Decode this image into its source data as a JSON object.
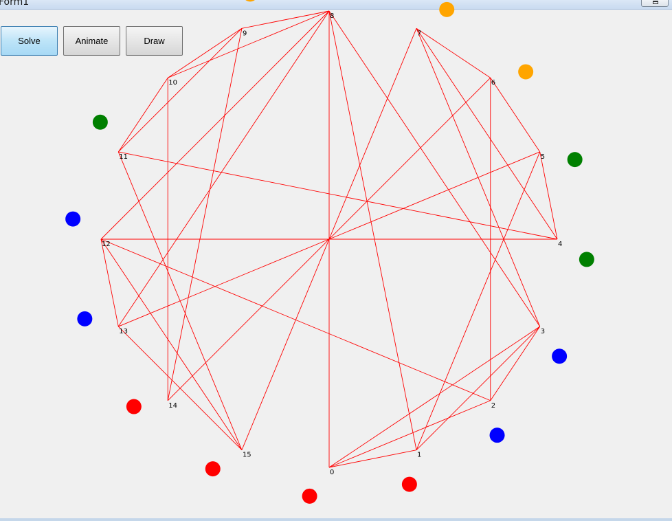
{
  "window": {
    "title": "Form1"
  },
  "toolbar": {
    "solve_label": "Solve",
    "animate_label": "Animate",
    "draw_label": "Draw"
  },
  "graph": {
    "line_color": "#ff0000",
    "node_labels": [
      "0",
      "1",
      "2",
      "3",
      "4",
      "5",
      "6",
      "7",
      "8",
      "9",
      "10",
      "11",
      "12",
      "13",
      "14",
      "15"
    ],
    "node_colors": [
      "#ff0000",
      "#ff0000",
      "#0000ff",
      "#0000ff",
      "#008000",
      "#008000",
      "#ffa500",
      "#ffa500",
      "#ffa500",
      "#ffa500",
      "#008000",
      "#008000",
      "#0000ff",
      "#0000ff",
      "#ff0000",
      "#ff0000"
    ],
    "edges": [
      [
        0,
        8
      ],
      [
        0,
        3
      ],
      [
        0,
        2
      ],
      [
        0,
        1
      ],
      [
        1,
        8
      ],
      [
        1,
        5
      ],
      [
        1,
        3
      ],
      [
        2,
        6
      ],
      [
        2,
        3
      ],
      [
        2,
        12
      ],
      [
        3,
        8
      ],
      [
        3,
        7
      ],
      [
        4,
        7
      ],
      [
        4,
        12
      ],
      [
        4,
        5
      ],
      [
        5,
        13
      ],
      [
        5,
        6
      ],
      [
        6,
        14
      ],
      [
        6,
        7
      ],
      [
        7,
        15
      ],
      [
        8,
        9
      ],
      [
        8,
        10
      ],
      [
        8,
        12
      ],
      [
        8,
        13
      ],
      [
        9,
        14
      ],
      [
        9,
        10
      ],
      [
        9,
        11
      ],
      [
        10,
        14
      ],
      [
        10,
        11
      ],
      [
        11,
        15
      ],
      [
        11,
        4
      ],
      [
        12,
        15
      ],
      [
        12,
        13
      ],
      [
        13,
        15
      ]
    ]
  }
}
